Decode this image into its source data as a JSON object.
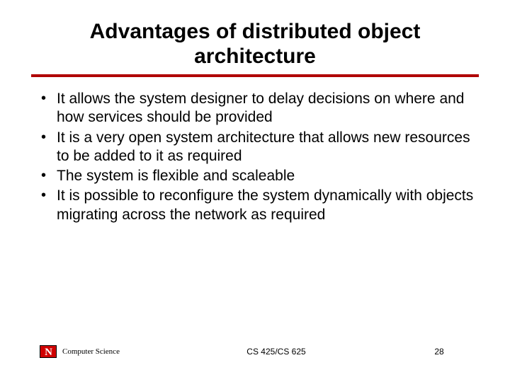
{
  "title": "Advantages of distributed object architecture",
  "bullets": [
    "It allows the system designer to delay decisions on where and how services should be provided",
    "It is a very open system architecture that allows new resources to be added to it as required",
    "The system is flexible and scaleable",
    "It is possible to reconfigure the system dynamically with objects migrating across the network as required"
  ],
  "footer": {
    "logo_letter": "N",
    "department": "Computer Science",
    "course": "CS 425/CS 625",
    "page": "28"
  },
  "colors": {
    "rule": "#b00000",
    "logo_bg": "#d00000"
  }
}
